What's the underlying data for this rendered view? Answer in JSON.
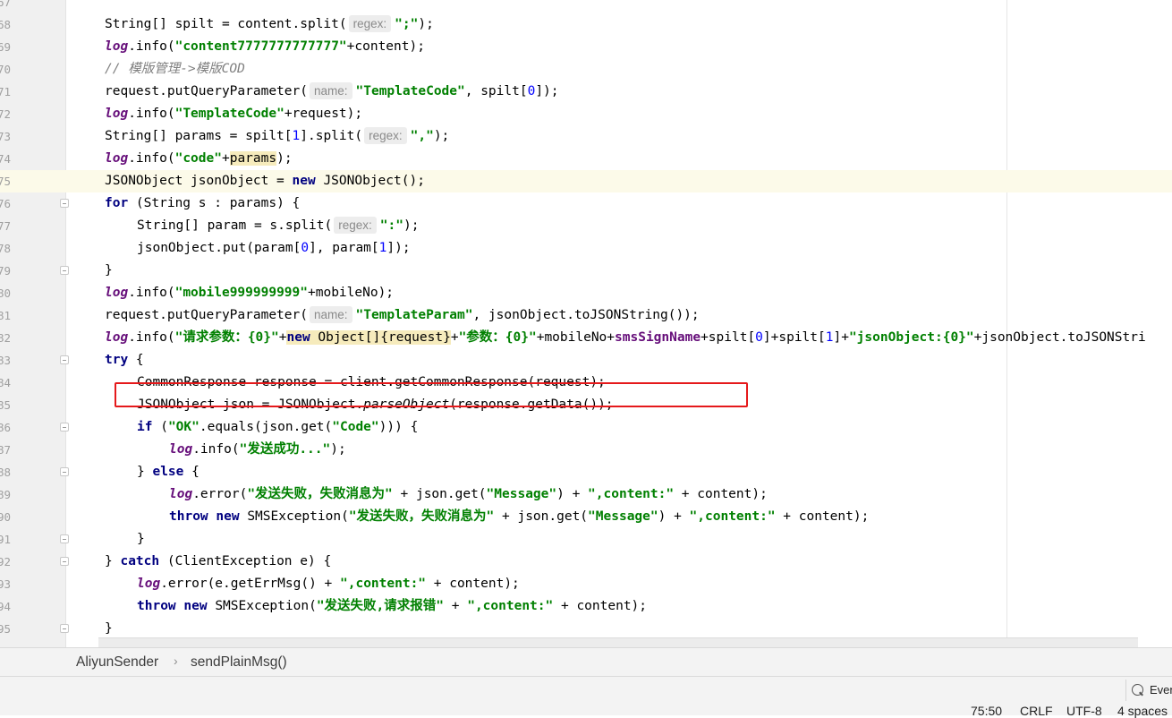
{
  "editor": {
    "lines": [
      {
        "n": "67",
        "segs": []
      },
      {
        "n": "68",
        "segs": [
          {
            "t": "String[] spilt = content.split("
          },
          {
            "t": "regex:",
            "c": "hint"
          },
          {
            "t": "\";\"",
            "c": "str"
          },
          {
            "t": ");"
          }
        ]
      },
      {
        "n": "69",
        "segs": [
          {
            "t": "log",
            "c": "log"
          },
          {
            "t": ".info("
          },
          {
            "t": "\"content7777777777777\"",
            "c": "str"
          },
          {
            "t": "+content);"
          }
        ]
      },
      {
        "n": "70",
        "segs": [
          {
            "t": "// 模版管理->模版COD",
            "c": "cmt"
          }
        ]
      },
      {
        "n": "71",
        "segs": [
          {
            "t": "request.putQueryParameter("
          },
          {
            "t": "name:",
            "c": "hint"
          },
          {
            "t": "\"TemplateCode\"",
            "c": "str"
          },
          {
            "t": ", spilt["
          },
          {
            "t": "0",
            "c": "num"
          },
          {
            "t": "]);"
          }
        ]
      },
      {
        "n": "72",
        "segs": [
          {
            "t": "log",
            "c": "log"
          },
          {
            "t": ".info("
          },
          {
            "t": "\"TemplateCode\"",
            "c": "str"
          },
          {
            "t": "+request);"
          }
        ]
      },
      {
        "n": "73",
        "segs": [
          {
            "t": "String[] params = spilt["
          },
          {
            "t": "1",
            "c": "num"
          },
          {
            "t": "].split("
          },
          {
            "t": "regex:",
            "c": "hint"
          },
          {
            "t": "\",\"",
            "c": "str"
          },
          {
            "t": ");"
          }
        ]
      },
      {
        "n": "74",
        "segs": [
          {
            "t": "log",
            "c": "log"
          },
          {
            "t": ".info("
          },
          {
            "t": "\"code\"",
            "c": "str"
          },
          {
            "t": "+"
          },
          {
            "t": "params",
            "c": "hl"
          },
          {
            "t": ");"
          }
        ]
      },
      {
        "n": "75",
        "current": true,
        "segs": [
          {
            "t": "JSONObject jsonObject = "
          },
          {
            "t": "new",
            "c": "kw"
          },
          {
            "t": " JSONObject();"
          }
        ]
      },
      {
        "n": "76",
        "fold": true,
        "segs": [
          {
            "t": "for",
            "c": "kw"
          },
          {
            "t": " (String s : params) {"
          }
        ]
      },
      {
        "n": "77",
        "indent": 1,
        "segs": [
          {
            "t": "String[] param = s.split("
          },
          {
            "t": "regex:",
            "c": "hint"
          },
          {
            "t": "\":\"",
            "c": "str"
          },
          {
            "t": ");"
          }
        ]
      },
      {
        "n": "78",
        "indent": 1,
        "segs": [
          {
            "t": "jsonObject.put(param["
          },
          {
            "t": "0",
            "c": "num"
          },
          {
            "t": "], param["
          },
          {
            "t": "1",
            "c": "num"
          },
          {
            "t": "]);"
          }
        ]
      },
      {
        "n": "79",
        "fold": true,
        "segs": [
          {
            "t": "}"
          }
        ]
      },
      {
        "n": "80",
        "segs": [
          {
            "t": "log",
            "c": "log"
          },
          {
            "t": ".info("
          },
          {
            "t": "\"mobile999999999\"",
            "c": "str"
          },
          {
            "t": "+mobileNo);"
          }
        ]
      },
      {
        "n": "81",
        "segs": [
          {
            "t": "request.putQueryParameter("
          },
          {
            "t": "name:",
            "c": "hint"
          },
          {
            "t": "\"TemplateParam\"",
            "c": "str"
          },
          {
            "t": ", jsonObject.toJSONString());"
          }
        ]
      },
      {
        "n": "82",
        "segs": [
          {
            "t": "log",
            "c": "log"
          },
          {
            "t": ".info("
          },
          {
            "t": "\"请求参数：{0}\"",
            "c": "str"
          },
          {
            "t": "+"
          },
          {
            "t": "new",
            "c": "kw hl"
          },
          {
            "t": " Object[]{request}",
            "c": "hl"
          },
          {
            "t": "+"
          },
          {
            "t": "\"参数：{0}\"",
            "c": "str"
          },
          {
            "t": "+mobileNo+"
          },
          {
            "t": "smsSignName",
            "c": "fld"
          },
          {
            "t": "+spilt["
          },
          {
            "t": "0",
            "c": "num"
          },
          {
            "t": "]+spilt["
          },
          {
            "t": "1",
            "c": "num"
          },
          {
            "t": "]+"
          },
          {
            "t": "\"jsonObject:{0}\"",
            "c": "str"
          },
          {
            "t": "+jsonObject.toJSONStri"
          }
        ]
      },
      {
        "n": "83",
        "fold": true,
        "segs": [
          {
            "t": "try",
            "c": "kw"
          },
          {
            "t": " {"
          }
        ]
      },
      {
        "n": "84",
        "indent": 1,
        "segs": [
          {
            "t": "CommonResponse response = client.getCommonResponse(request);"
          }
        ]
      },
      {
        "n": "85",
        "indent": 1,
        "segs": [
          {
            "t": "JSONObject json = JSONObject."
          },
          {
            "t": "parseObject",
            "c": "it"
          },
          {
            "t": "(response.getData());"
          }
        ]
      },
      {
        "n": "86",
        "indent": 1,
        "fold": true,
        "segs": [
          {
            "t": "if",
            "c": "kw"
          },
          {
            "t": " ("
          },
          {
            "t": "\"OK\"",
            "c": "str"
          },
          {
            "t": ".equals(json.get("
          },
          {
            "t": "\"Code\"",
            "c": "str"
          },
          {
            "t": "))) {"
          }
        ]
      },
      {
        "n": "87",
        "indent": 2,
        "segs": [
          {
            "t": "log",
            "c": "log"
          },
          {
            "t": ".info("
          },
          {
            "t": "\"发送成功...\"",
            "c": "str"
          },
          {
            "t": ");"
          }
        ]
      },
      {
        "n": "88",
        "indent": 1,
        "fold": true,
        "segs": [
          {
            "t": "} "
          },
          {
            "t": "else",
            "c": "kw"
          },
          {
            "t": " {"
          }
        ]
      },
      {
        "n": "89",
        "indent": 2,
        "segs": [
          {
            "t": "log",
            "c": "log"
          },
          {
            "t": ".error("
          },
          {
            "t": "\"发送失败，失败消息为\"",
            "c": "str"
          },
          {
            "t": " + json.get("
          },
          {
            "t": "\"Message\"",
            "c": "str"
          },
          {
            "t": ") + "
          },
          {
            "t": "\",content:\"",
            "c": "str"
          },
          {
            "t": " + content);"
          }
        ]
      },
      {
        "n": "90",
        "indent": 2,
        "segs": [
          {
            "t": "throw",
            "c": "kw"
          },
          {
            "t": " "
          },
          {
            "t": "new",
            "c": "kw"
          },
          {
            "t": " SMSException("
          },
          {
            "t": "\"发送失败，失败消息为\"",
            "c": "str"
          },
          {
            "t": " + json.get("
          },
          {
            "t": "\"Message\"",
            "c": "str"
          },
          {
            "t": ") + "
          },
          {
            "t": "\",content:\"",
            "c": "str"
          },
          {
            "t": " + content);"
          }
        ]
      },
      {
        "n": "91",
        "indent": 1,
        "fold": true,
        "segs": [
          {
            "t": "}"
          }
        ]
      },
      {
        "n": "92",
        "fold": true,
        "segs": [
          {
            "t": "} "
          },
          {
            "t": "catch",
            "c": "kw"
          },
          {
            "t": " (ClientException e) {"
          }
        ]
      },
      {
        "n": "93",
        "indent": 1,
        "segs": [
          {
            "t": "log",
            "c": "log"
          },
          {
            "t": ".error(e.getErrMsg() + "
          },
          {
            "t": "\",content:\"",
            "c": "str"
          },
          {
            "t": " + content);"
          }
        ]
      },
      {
        "n": "94",
        "indent": 1,
        "segs": [
          {
            "t": "throw",
            "c": "kw"
          },
          {
            "t": " "
          },
          {
            "t": "new",
            "c": "kw"
          },
          {
            "t": " SMSException("
          },
          {
            "t": "\"发送失败,请求报错\"",
            "c": "str"
          },
          {
            "t": " + "
          },
          {
            "t": "\",content:\"",
            "c": "str"
          },
          {
            "t": " + content);"
          }
        ]
      },
      {
        "n": "95",
        "fold": true,
        "segs": [
          {
            "t": "}"
          }
        ]
      }
    ]
  },
  "breadcrumb": {
    "class_name": "AliyunSender",
    "separator": "›",
    "method_name": "sendPlainMsg()"
  },
  "event_log": {
    "label": "Even",
    "icon": "magnifier-icon"
  },
  "status_bar": {
    "position": "75:50",
    "line_separator": "CRLF",
    "encoding": "UTF-8",
    "indent": "4 spaces"
  },
  "colors": {
    "keyword": "#000080",
    "string": "#008000",
    "log_field": "#660e7a",
    "comment": "#808080",
    "number": "#0000ff",
    "annotation_box": "#e5191b",
    "current_line": "#fcfae9"
  }
}
